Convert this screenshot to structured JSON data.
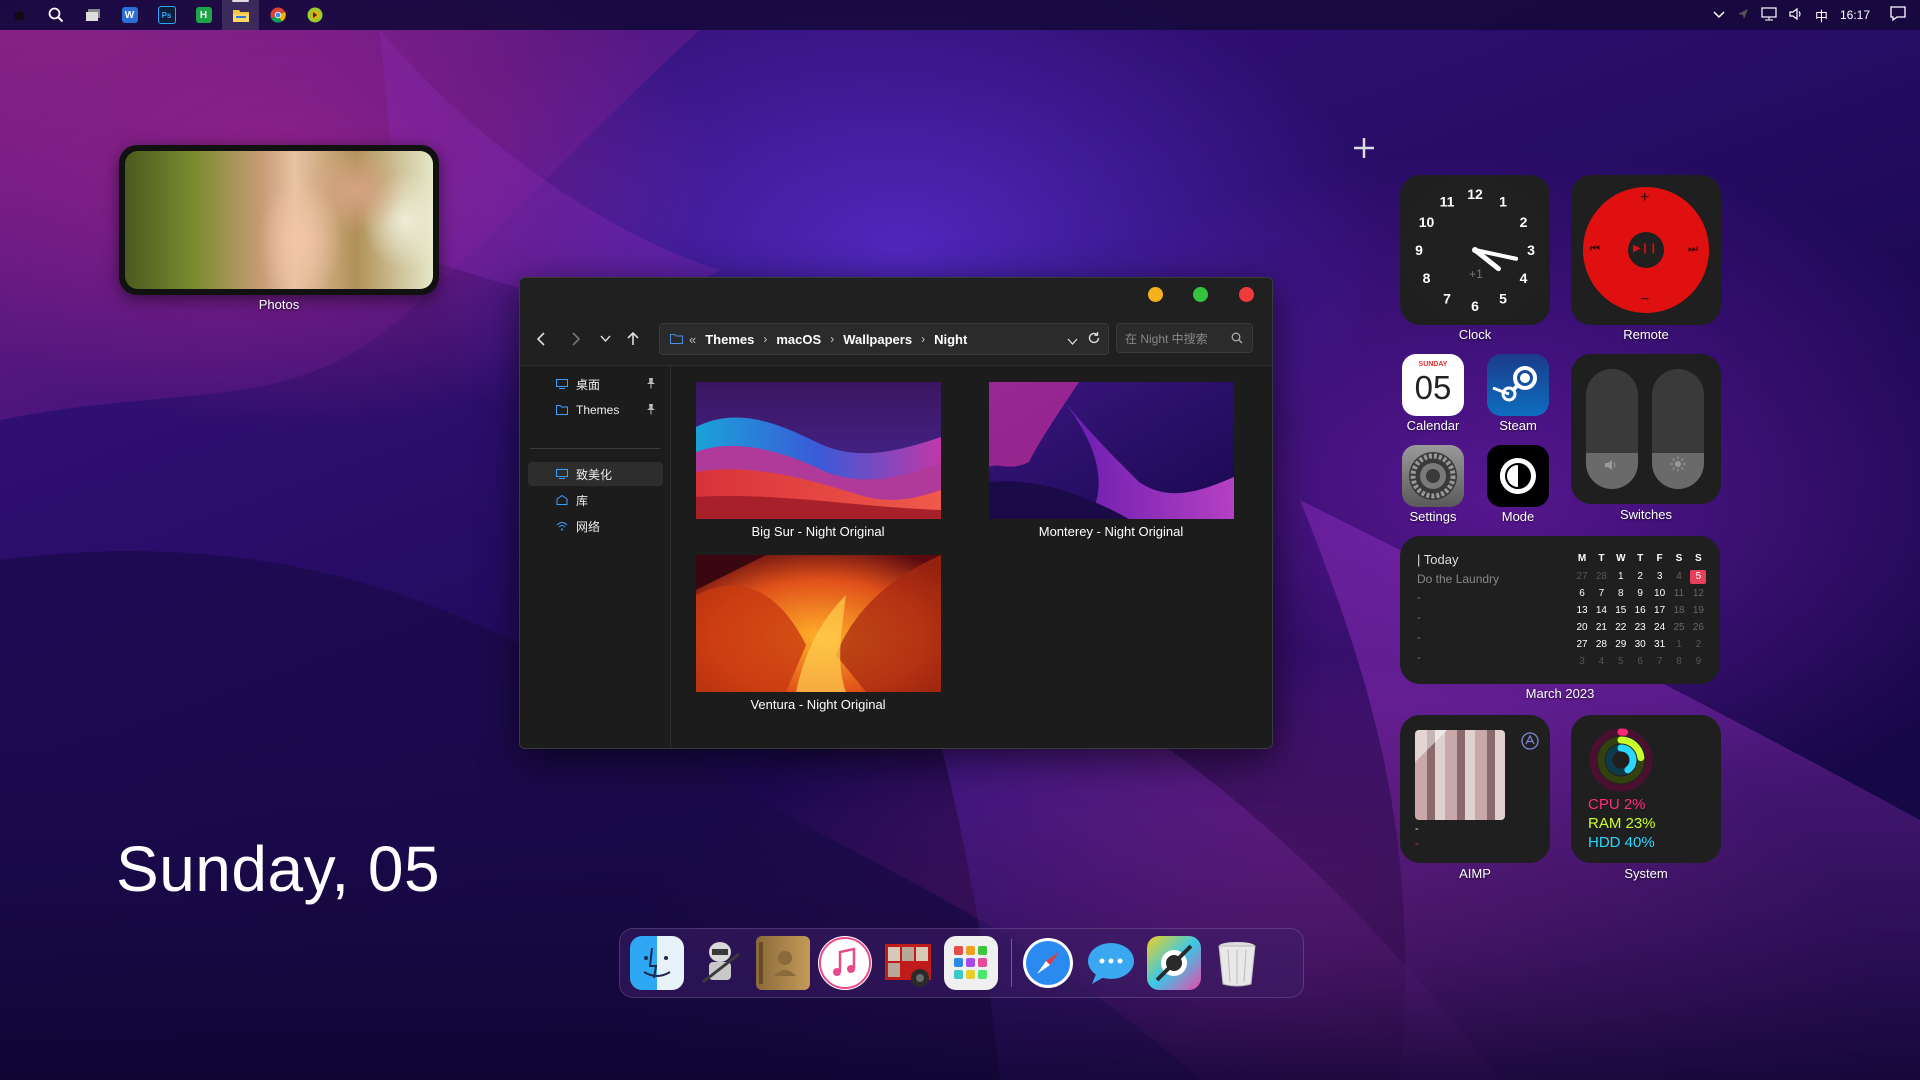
{
  "taskbar": {
    "apps": [
      {
        "name": "apple-icon",
        "label": ""
      },
      {
        "name": "search-icon",
        "label": ""
      },
      {
        "name": "task-view-icon",
        "label": ""
      },
      {
        "name": "word-icon",
        "label": "W"
      },
      {
        "name": "photoshop-icon",
        "label": "Ps"
      },
      {
        "name": "h-app-icon",
        "label": "H"
      },
      {
        "name": "file-explorer-icon",
        "label": ""
      },
      {
        "name": "chrome-icon",
        "label": ""
      },
      {
        "name": "globe-app-icon",
        "label": ""
      }
    ],
    "ime": "中",
    "time": "16:17"
  },
  "photos_widget": {
    "label": "Photos"
  },
  "big_date": "Sunday, 05",
  "explorer": {
    "breadcrumb": [
      "Themes",
      "macOS",
      "Wallpapers",
      "Night"
    ],
    "breadcrumb_prefix": "«",
    "search_placeholder": "在 Night 中搜索",
    "sidebar": {
      "pinned": [
        {
          "label": "桌面"
        },
        {
          "label": "Themes"
        }
      ],
      "items": [
        {
          "label": "致美化"
        },
        {
          "label": "库"
        },
        {
          "label": "网络"
        }
      ]
    },
    "files": [
      {
        "label": "Big Sur - Night Original"
      },
      {
        "label": "Monterey - Night Original"
      },
      {
        "label": "Ventura - Night Original"
      }
    ]
  },
  "widgets": {
    "clock": {
      "label": "Clock",
      "numbers": [
        "12",
        "1",
        "2",
        "3",
        "4",
        "5",
        "6",
        "7",
        "8",
        "9",
        "10",
        "11"
      ],
      "offset": "+1",
      "hour": 4,
      "minute": 17
    },
    "remote": {
      "label": "Remote",
      "plus": "+",
      "minus": "−",
      "prev": "⏮",
      "play": "▶❙❙",
      "next": "⏭"
    },
    "calendar_icon": {
      "label": "Calendar",
      "day": "SUNDAY",
      "date": "05"
    },
    "steam": {
      "label": "Steam"
    },
    "settings": {
      "label": "Settings"
    },
    "mode": {
      "label": "Mode"
    },
    "switches": {
      "label": "Switches",
      "volume_level": 0.3,
      "brightness_level": 0.3
    },
    "month_calendar": {
      "label": "March 2023",
      "today_title": "| Today",
      "task": "Do the Laundry",
      "dashes": [
        "-",
        "-",
        "-",
        "-"
      ],
      "weekdays": [
        "M",
        "T",
        "W",
        "T",
        "F",
        "S",
        "S"
      ],
      "weeks": [
        [
          "27",
          "28",
          "1",
          "2",
          "3",
          "4",
          "5"
        ],
        [
          "6",
          "7",
          "8",
          "9",
          "10",
          "11",
          "12"
        ],
        [
          "13",
          "14",
          "15",
          "16",
          "17",
          "18",
          "19"
        ],
        [
          "20",
          "21",
          "22",
          "23",
          "24",
          "25",
          "26"
        ],
        [
          "27",
          "28",
          "29",
          "30",
          "31",
          "1",
          "2"
        ],
        [
          "3",
          "4",
          "5",
          "6",
          "7",
          "8",
          "9"
        ]
      ],
      "today": "5"
    },
    "aimp": {
      "label": "AIMP",
      "line1": "-",
      "line2": "-"
    },
    "system": {
      "label": "System",
      "cpu": "CPU 2%",
      "ram": "RAM 23%",
      "hdd": "HDD 40%",
      "cpu_value": 0.02,
      "ram_value": 0.23,
      "hdd_value": 0.4
    }
  },
  "dock": {
    "apps": [
      "finder-icon",
      "automator-icon",
      "contacts-icon",
      "itunes-icon",
      "photo-booth-icon",
      "launchpad-icon",
      "safari-icon",
      "messages-icon",
      "system-tools-icon",
      "trash-icon"
    ]
  }
}
